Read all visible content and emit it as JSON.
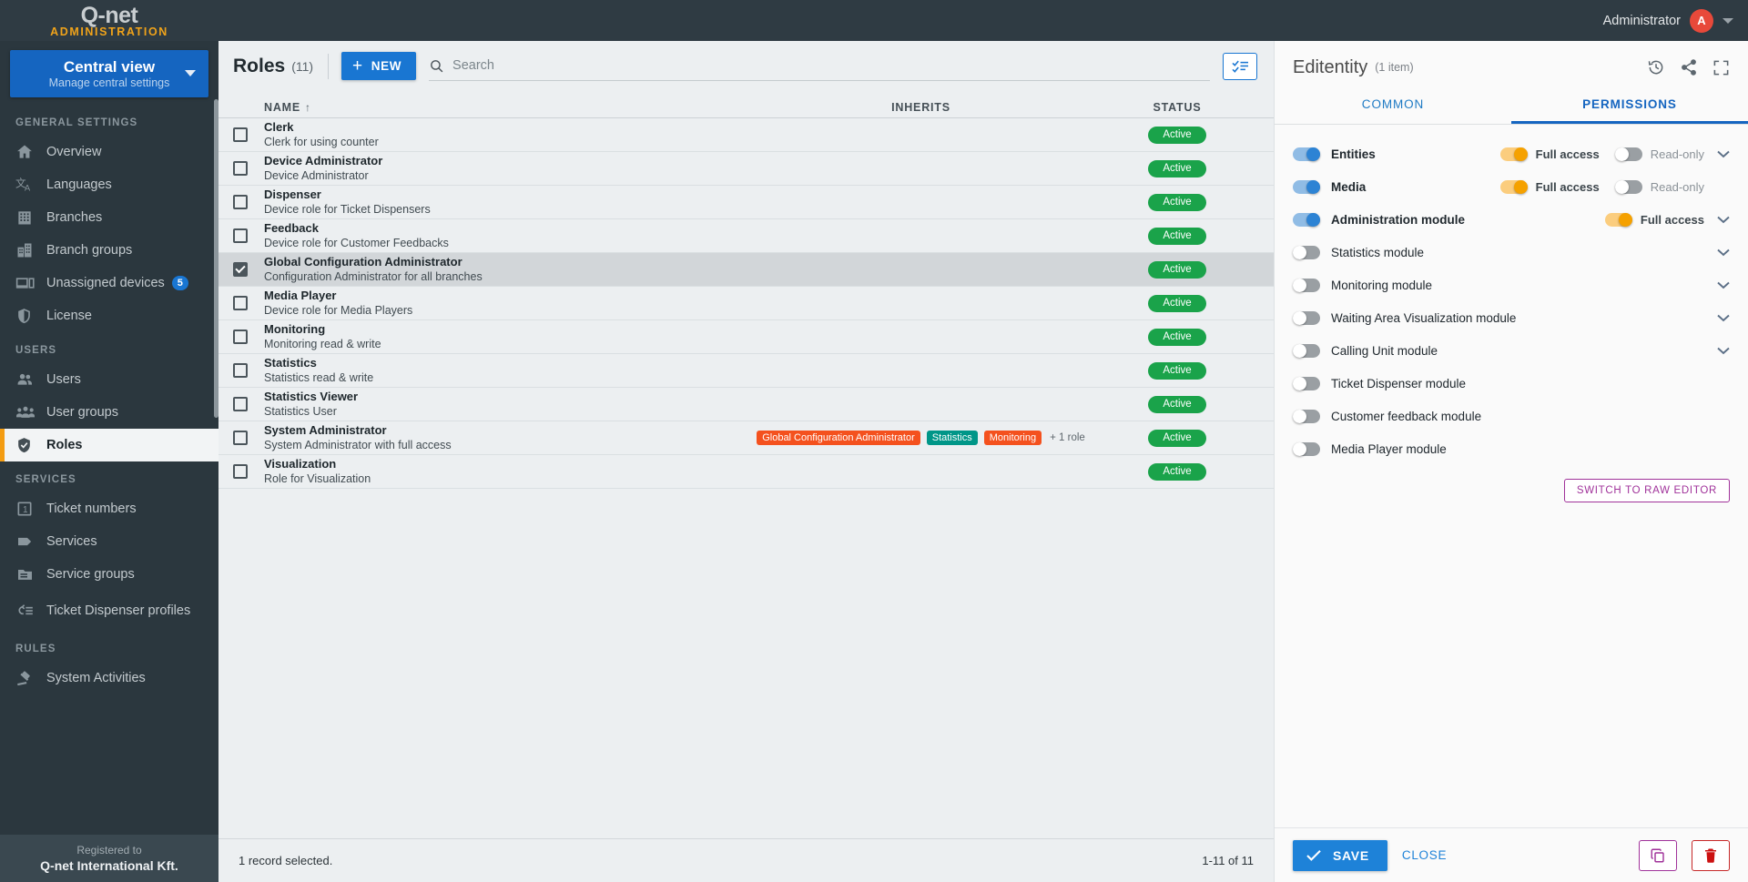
{
  "topbar": {
    "logo_main": "Q-net",
    "logo_sub": "ADMINISTRATION",
    "admin_name": "Administrator",
    "avatar_initial": "A"
  },
  "sidebar": {
    "central_view": {
      "title": "Central view",
      "subtitle": "Manage central settings"
    },
    "sections": [
      {
        "label": "GENERAL SETTINGS",
        "items": [
          {
            "label": "Overview",
            "icon": "home-icon",
            "active": false
          },
          {
            "label": "Languages",
            "icon": "translate-icon",
            "active": false
          },
          {
            "label": "Branches",
            "icon": "building-icon",
            "active": false
          },
          {
            "label": "Branch groups",
            "icon": "buildings-icon",
            "active": false
          },
          {
            "label": "Unassigned devices",
            "icon": "devices-icon",
            "active": false,
            "badge": "5"
          },
          {
            "label": "License",
            "icon": "shield-icon",
            "active": false
          }
        ]
      },
      {
        "label": "USERS",
        "items": [
          {
            "label": "Users",
            "icon": "users-icon",
            "active": false
          },
          {
            "label": "User groups",
            "icon": "user-group-icon",
            "active": false
          },
          {
            "label": "Roles",
            "icon": "shield-check-icon",
            "active": true
          }
        ]
      },
      {
        "label": "SERVICES",
        "items": [
          {
            "label": "Ticket numbers",
            "icon": "number-one-icon",
            "active": false
          },
          {
            "label": "Services",
            "icon": "tag-icon",
            "active": false
          },
          {
            "label": "Service groups",
            "icon": "folder-icon",
            "active": false
          },
          {
            "label": "Ticket Dispenser profiles",
            "icon": "dispenser-icon",
            "active": false,
            "two_line": true
          }
        ]
      },
      {
        "label": "RULES",
        "items": [
          {
            "label": "System Activities",
            "icon": "gavel-icon",
            "active": false
          }
        ]
      }
    ],
    "footer": {
      "registered_label": "Registered to",
      "company": "Q-net International Kft."
    }
  },
  "main": {
    "title": "Roles",
    "count": "(11)",
    "new_button": "NEW",
    "search_placeholder": "Search",
    "search_value": "",
    "columns": {
      "name": "NAME",
      "inherits": "INHERITS",
      "status": "STATUS"
    },
    "sort_arrow": "↑",
    "rows": [
      {
        "name": "Clerk",
        "description": "Clerk for using counter",
        "inherits": [],
        "more": "",
        "status": "Active",
        "selected": false
      },
      {
        "name": "Device Administrator",
        "description": "Device Administrator",
        "inherits": [],
        "more": "",
        "status": "Active",
        "selected": false
      },
      {
        "name": "Dispenser",
        "description": "Device role for Ticket Dispensers",
        "inherits": [],
        "more": "",
        "status": "Active",
        "selected": false
      },
      {
        "name": "Feedback",
        "description": "Device role for Customer Feedbacks",
        "inherits": [],
        "more": "",
        "status": "Active",
        "selected": false
      },
      {
        "name": "Global Configuration Administrator",
        "description": "Configuration Administrator for all branches",
        "inherits": [],
        "more": "",
        "status": "Active",
        "selected": true
      },
      {
        "name": "Media Player",
        "description": "Device role for Media Players",
        "inherits": [],
        "more": "",
        "status": "Active",
        "selected": false
      },
      {
        "name": "Monitoring",
        "description": "Monitoring read & write",
        "inherits": [],
        "more": "",
        "status": "Active",
        "selected": false
      },
      {
        "name": "Statistics",
        "description": "Statistics read & write",
        "inherits": [],
        "more": "",
        "status": "Active",
        "selected": false
      },
      {
        "name": "Statistics Viewer",
        "description": "Statistics User",
        "inherits": [],
        "more": "",
        "status": "Active",
        "selected": false
      },
      {
        "name": "System Administrator",
        "description": "System Administrator with full access",
        "inherits": [
          {
            "label": "Global Configuration Administrator",
            "color": "orange"
          },
          {
            "label": "Statistics",
            "color": "teal"
          },
          {
            "label": "Monitoring",
            "color": "orange"
          }
        ],
        "more": "+ 1 role",
        "status": "Active",
        "selected": false
      },
      {
        "name": "Visualization",
        "description": "Role for Visualization",
        "inherits": [],
        "more": "",
        "status": "Active",
        "selected": false
      }
    ],
    "footer_status": "1 record selected.",
    "pagination": "1-11 of 11"
  },
  "panel": {
    "title": "Editentity",
    "subtitle": "(1 item)",
    "tabs": [
      {
        "label": "COMMON",
        "active": false
      },
      {
        "label": "PERMISSIONS",
        "active": true
      }
    ],
    "permissions": [
      {
        "label": "Entities",
        "bold": true,
        "enabled": true,
        "full_access_on": true,
        "full_access_label": "Full access",
        "read_only_shown": true,
        "read_only_on": false,
        "read_only_label": "Read-only",
        "chevron": true
      },
      {
        "label": "Media",
        "bold": true,
        "enabled": true,
        "full_access_on": true,
        "full_access_label": "Full access",
        "read_only_shown": true,
        "read_only_on": false,
        "read_only_label": "Read-only",
        "chevron": false
      },
      {
        "label": "Administration module",
        "bold": true,
        "enabled": true,
        "full_access_on": true,
        "full_access_label": "Full access",
        "read_only_shown": false,
        "read_only_on": false,
        "read_only_label": "",
        "chevron": true
      },
      {
        "label": "Statistics module",
        "bold": false,
        "enabled": false,
        "full_access_on": false,
        "full_access_label": "",
        "read_only_shown": false,
        "read_only_on": false,
        "read_only_label": "",
        "chevron": true
      },
      {
        "label": "Monitoring module",
        "bold": false,
        "enabled": false,
        "full_access_on": false,
        "full_access_label": "",
        "read_only_shown": false,
        "read_only_on": false,
        "read_only_label": "",
        "chevron": true
      },
      {
        "label": "Waiting Area Visualization module",
        "bold": false,
        "enabled": false,
        "full_access_on": false,
        "full_access_label": "",
        "read_only_shown": false,
        "read_only_on": false,
        "read_only_label": "",
        "chevron": true
      },
      {
        "label": "Calling Unit module",
        "bold": false,
        "enabled": false,
        "full_access_on": false,
        "full_access_label": "",
        "read_only_shown": false,
        "read_only_on": false,
        "read_only_label": "",
        "chevron": true
      },
      {
        "label": "Ticket Dispenser module",
        "bold": false,
        "enabled": false,
        "full_access_on": false,
        "full_access_label": "",
        "read_only_shown": false,
        "read_only_on": false,
        "read_only_label": "",
        "chevron": false
      },
      {
        "label": "Customer feedback module",
        "bold": false,
        "enabled": false,
        "full_access_on": false,
        "full_access_label": "",
        "read_only_shown": false,
        "read_only_on": false,
        "read_only_label": "",
        "chevron": false
      },
      {
        "label": "Media Player module",
        "bold": false,
        "enabled": false,
        "full_access_on": false,
        "full_access_label": "",
        "read_only_shown": false,
        "read_only_on": false,
        "read_only_label": "",
        "chevron": false
      }
    ],
    "raw_editor_button": "SWITCH TO RAW EDITOR",
    "save_button": "SAVE",
    "close_button": "CLOSE"
  },
  "colors": {
    "accent_blue": "#1976d2",
    "brand_orange": "#f0a31a",
    "active_green": "#1aa34a",
    "chip_orange": "#f4511e",
    "chip_teal": "#009688",
    "purple": "#a0329a",
    "red": "#cc1111"
  }
}
